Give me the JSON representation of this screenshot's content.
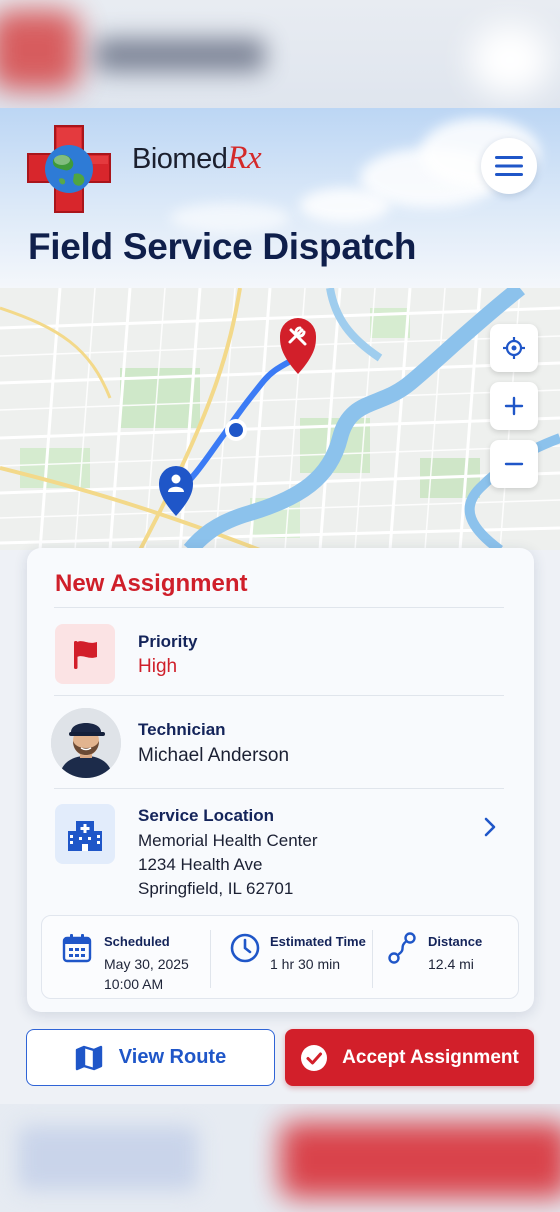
{
  "brand": {
    "name_main": "Biomed",
    "name_rx": "Rx"
  },
  "header": {
    "title": "Field Service Dispatch"
  },
  "map": {
    "controls": [
      "locate-icon",
      "plus-icon",
      "minus-icon"
    ],
    "markers": [
      "wrench-marker",
      "technician-marker",
      "current-position-dot"
    ]
  },
  "assignment": {
    "title": "New Assignment",
    "priority": {
      "label": "Priority",
      "value": "High"
    },
    "technician": {
      "label": "Technician",
      "value": "Michael Anderson"
    },
    "location": {
      "label": "Service Location",
      "name": "Memorial Health Center",
      "street": "1234 Health Ave",
      "city": "Springfield, IL 62701"
    },
    "stats": {
      "scheduled": {
        "label": "Scheduled",
        "date": "May 30, 2025",
        "time": "10:00 AM"
      },
      "estimated": {
        "label": "Estimated Time",
        "value": "1 hr 30 min"
      },
      "distance": {
        "label": "Distance",
        "value": "12.4 mi"
      }
    }
  },
  "actions": {
    "view_route": "View Route",
    "accept": "Accept Assignment"
  },
  "colors": {
    "brand_red": "#d21f2a",
    "navy": "#0f1f4b",
    "accent_blue": "#1f56c8",
    "route_blue": "#3b7bf5"
  }
}
